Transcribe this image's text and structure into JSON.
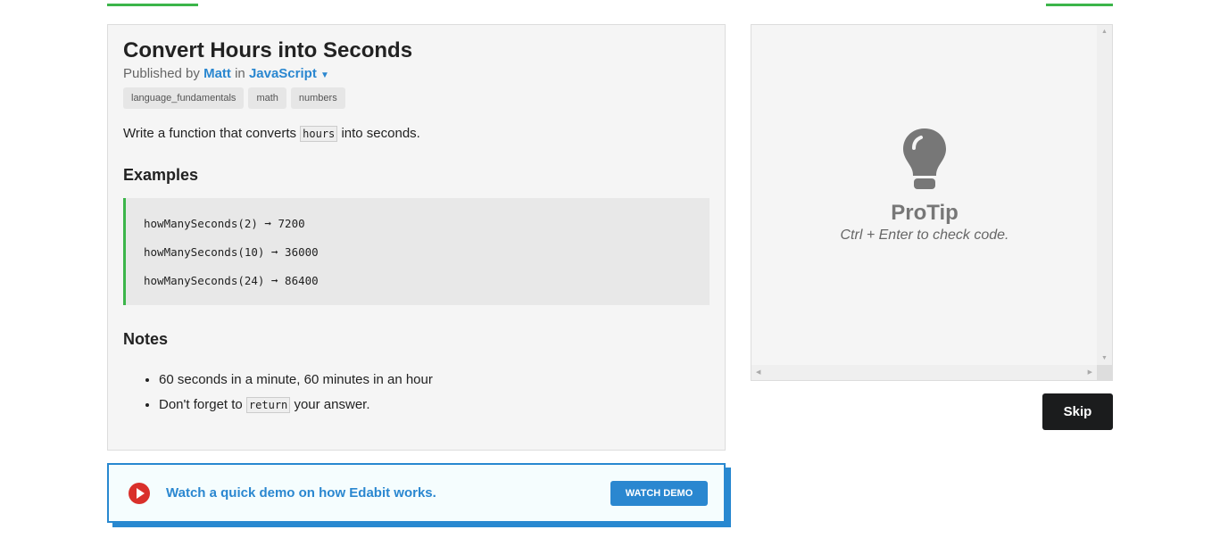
{
  "challenge": {
    "title": "Convert Hours into Seconds",
    "published_by": "Published by",
    "author": "Matt",
    "in": "in",
    "language": "JavaScript",
    "tags": [
      "language_fundamentals",
      "math",
      "numbers"
    ],
    "desc_before": "Write a function that converts",
    "desc_code": "hours",
    "desc_after": "into seconds.",
    "examples_heading": "Examples",
    "examples": [
      "howManySeconds(2) ➞ 7200",
      "howManySeconds(10) ➞ 36000",
      "howManySeconds(24) ➞ 86400"
    ],
    "notes_heading": "Notes",
    "note1": "60 seconds in a minute, 60 minutes in an hour",
    "note2_before": "Don't forget to",
    "note2_code": "return",
    "note2_after": "your answer."
  },
  "demo": {
    "text": "Watch a quick demo on how Edabit works.",
    "button": "WATCH DEMO"
  },
  "protip": {
    "title": "ProTip",
    "text": "Ctrl + Enter to check code."
  },
  "skip": "Skip",
  "colors": {
    "accent": "#2a87d0",
    "green": "#3cb54a",
    "play": "#d9302b"
  }
}
